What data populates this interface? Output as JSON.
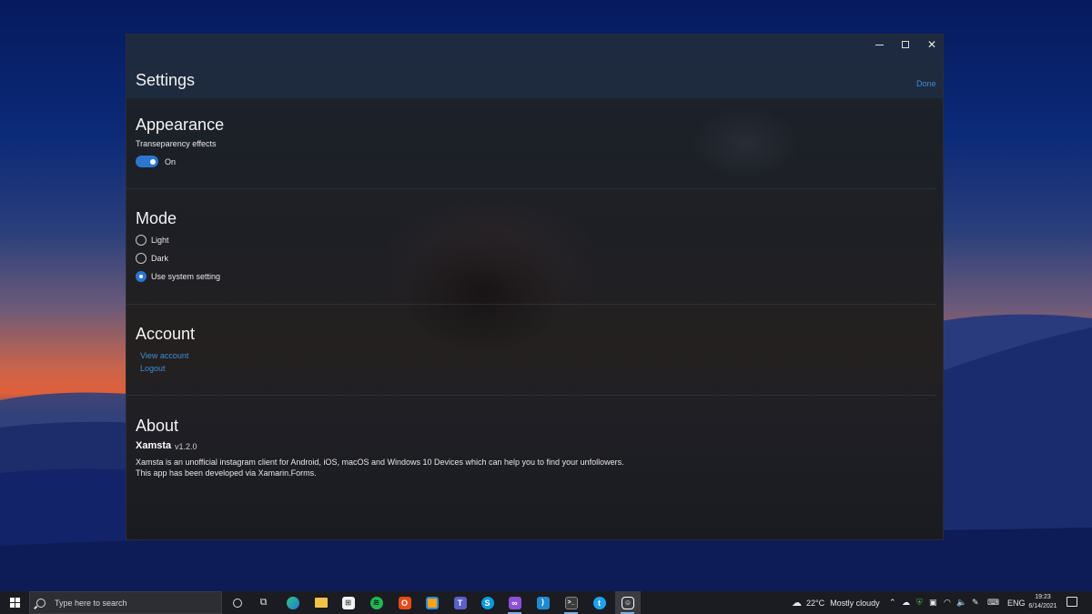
{
  "window": {
    "title": "Settings",
    "done_label": "Done",
    "controls": {
      "minimize_icon": "minimize-icon",
      "maximize_icon": "maximize-icon",
      "close_icon": "close-icon"
    }
  },
  "appearance": {
    "title": "Appearance",
    "setting_label": "Transeparency effects",
    "toggle_state": "On",
    "toggle_on": true
  },
  "mode": {
    "title": "Mode",
    "options": [
      {
        "label": "Light",
        "checked": false
      },
      {
        "label": "Dark",
        "checked": false
      },
      {
        "label": "Use system setting",
        "checked": true
      }
    ]
  },
  "account": {
    "title": "Account",
    "links": [
      "View account",
      "Logout"
    ]
  },
  "about": {
    "title": "About",
    "app_name": "Xamsta",
    "version": "v1.2.0",
    "description_1": "Xamsta is an unofficial instagram client for Android, iOS, macOS and Windows 10 Devices which can help you to find your unfollowers.",
    "description_2": "This app has been developed via Xamarin.Forms."
  },
  "taskbar": {
    "search_placeholder": "Type here to search",
    "apps": [
      "task-view",
      "widgets",
      "edge",
      "file-explorer",
      "microsoft-store",
      "spotify",
      "office",
      "app-orange",
      "teams",
      "skype",
      "visual-studio",
      "vs-code",
      "terminal",
      "twitter",
      "xamsta"
    ],
    "weather_temp": "22°C",
    "weather_text": "Mostly cloudy",
    "language": "ENG",
    "time": "19:23",
    "date": "6/14/2021"
  },
  "colors": {
    "accent": "#2c76cf",
    "link": "#3b8fd6",
    "taskbar": "#1b1c22"
  }
}
